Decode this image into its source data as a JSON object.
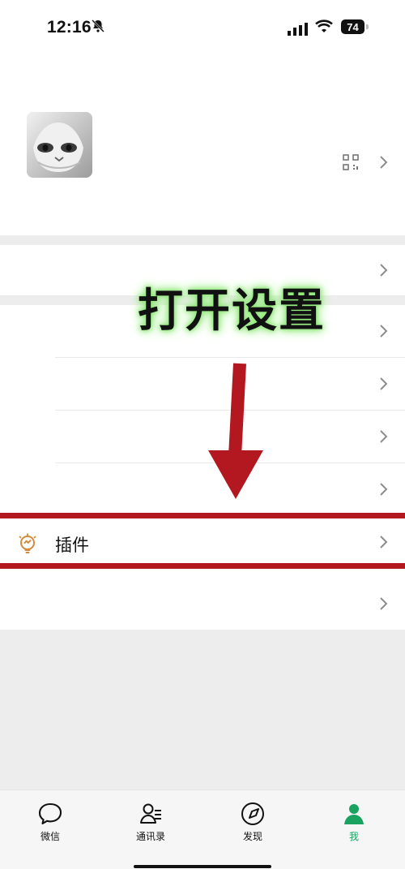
{
  "status_bar": {
    "time": "12:16",
    "battery_level": "74",
    "icons": [
      "bell-off-icon",
      "signal-icon",
      "wifi-icon",
      "battery-icon"
    ]
  },
  "profile": {
    "avatar_icon": "cat-avatar-icon",
    "qr_icon": "qr-code-icon",
    "chevron_icon": "chevron-right-icon"
  },
  "overlay": {
    "text": "打开设置",
    "highlight_color": "#b3171f",
    "glow_color": "#90e67b"
  },
  "menu": {
    "rows": [
      {
        "label": "",
        "chevron": "chevron-right-icon"
      },
      {
        "label": "",
        "chevron": "chevron-right-icon"
      },
      {
        "label": "",
        "chevron": "chevron-right-icon"
      },
      {
        "label": "",
        "chevron": "chevron-right-icon"
      },
      {
        "label": "",
        "chevron": "chevron-right-icon"
      },
      {
        "label": "插件",
        "icon": "plugin-bulb-icon",
        "chevron": "chevron-right-icon"
      },
      {
        "label": "",
        "chevron": "chevron-right-icon"
      }
    ]
  },
  "tabbar": {
    "tabs": [
      {
        "label": "微信",
        "icon": "chat-bubble-icon",
        "active": false
      },
      {
        "label": "通讯录",
        "icon": "contacts-icon",
        "active": false
      },
      {
        "label": "发现",
        "icon": "compass-icon",
        "active": false
      },
      {
        "label": "我",
        "icon": "person-icon",
        "active": true
      }
    ],
    "active_color": "#1aa260"
  }
}
